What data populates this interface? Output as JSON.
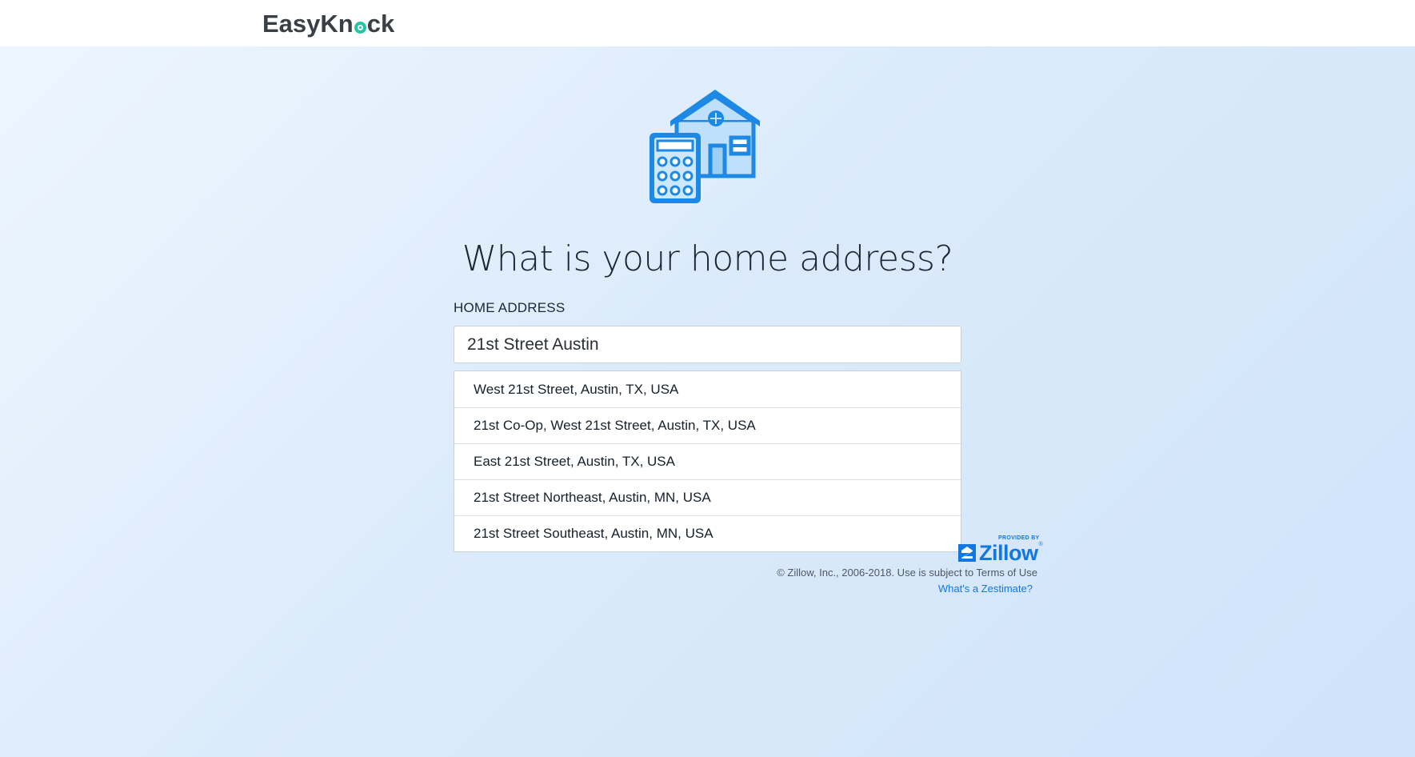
{
  "header": {
    "brand_part1": "EasyKn",
    "brand_part2": "ck"
  },
  "main": {
    "headline": "What is your home address?",
    "field_label": "HOME ADDRESS",
    "address_value": "21st Street Austin",
    "suggestions": [
      "West 21st Street, Austin, TX, USA",
      "21st Co-Op, West 21st Street, Austin, TX, USA",
      "East 21st Street, Austin, TX, USA",
      "21st Street Northeast, Austin, MN, USA",
      "21st Street Southeast, Austin, MN, USA"
    ]
  },
  "zillow": {
    "provided_by": "PROVIDED BY",
    "brand": "Zillow",
    "registered": "®",
    "copyright": "© Zillow, Inc., 2006-2018. Use is subject to Terms of Use",
    "zestimate_link": "What's a Zestimate?"
  },
  "colors": {
    "accent": "#1277e1",
    "brand_dot": "#1fc8a3",
    "icon_fill": "#1e88e5",
    "icon_light": "#bfe0fb"
  },
  "icons": {
    "hero": "house-calculator-icon",
    "zillow": "zillow-z-icon"
  }
}
